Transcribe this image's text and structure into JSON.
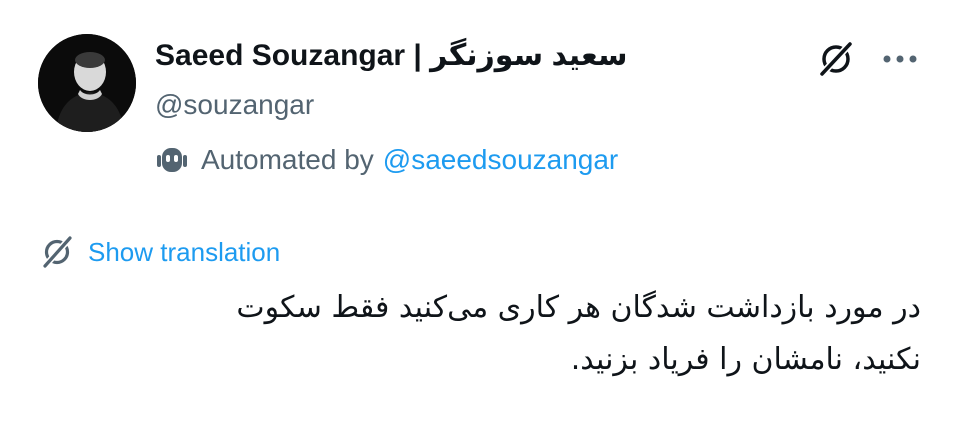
{
  "author": {
    "display_name": "Saeed Souzangar | سعید سوزنگر",
    "handle": "@souzangar"
  },
  "automation": {
    "label": "Automated by",
    "link": "@saeedsouzangar"
  },
  "icons": {
    "bot": "robot-icon",
    "grok": "grok-icon",
    "more": "more-options-icon",
    "translate": "translate-icon"
  },
  "translation": {
    "label": "Show translation"
  },
  "tweet": {
    "lines": [
      "در مورد بازداشت شدگان هر کاری می‌کنید فقط سکوت",
      "نکنید، نامشان را فریاد بزنید."
    ]
  },
  "colors": {
    "text": "#0f1419",
    "secondary": "#536471",
    "accent": "#1d9bf0"
  }
}
